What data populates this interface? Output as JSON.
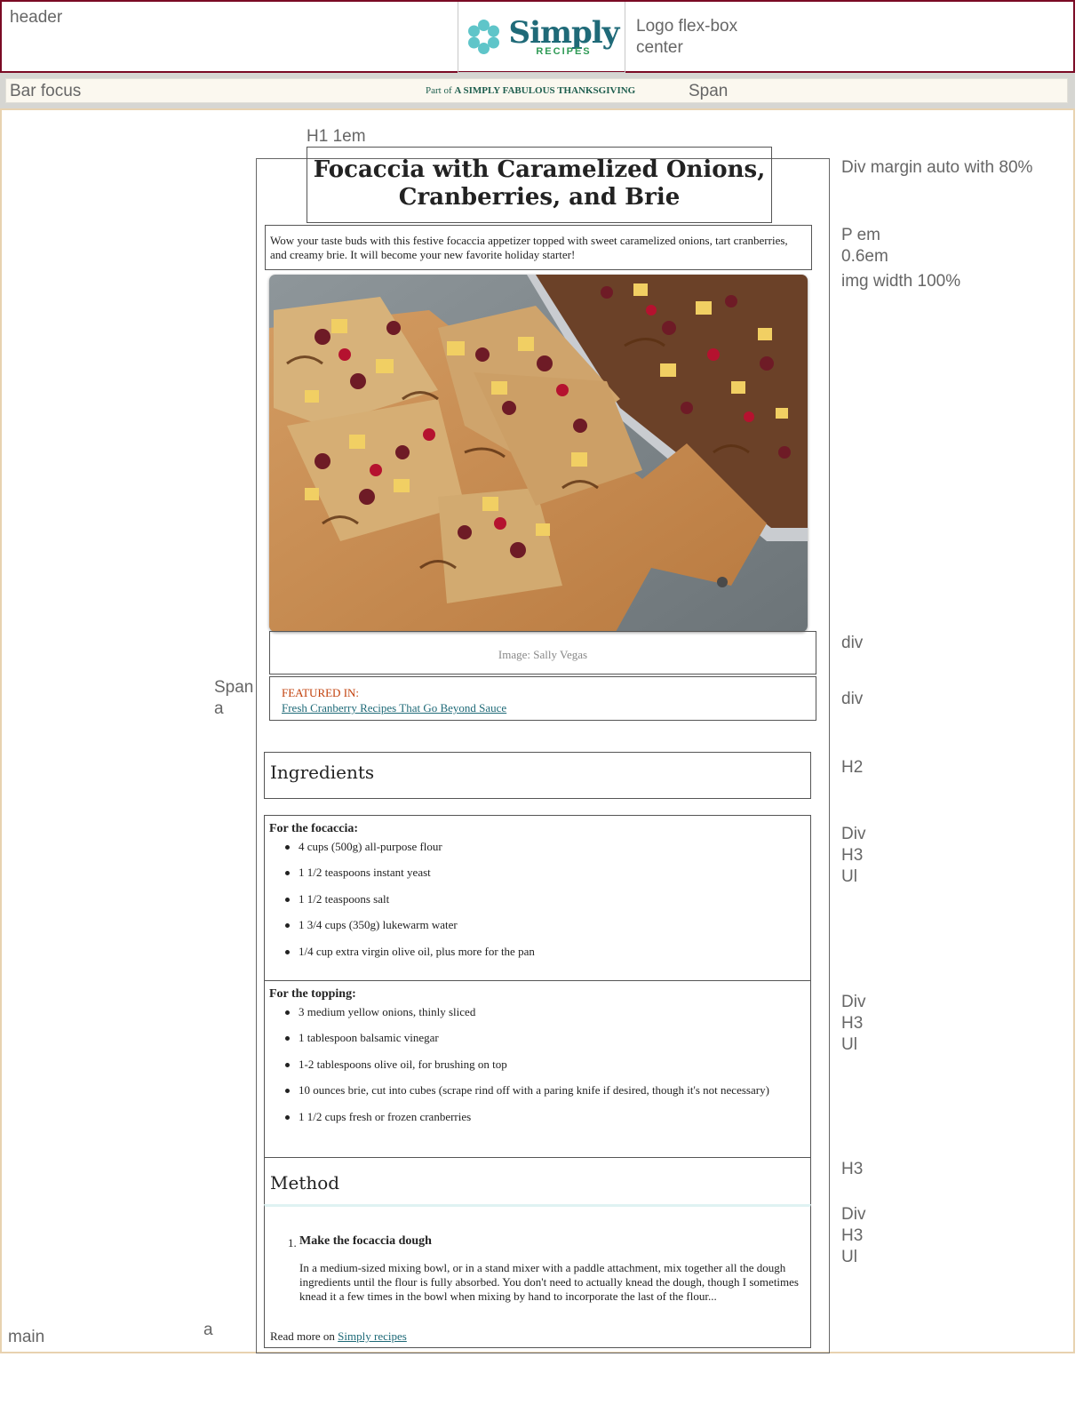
{
  "annotations": {
    "header": "header",
    "logo": "Logo flex-box center",
    "bar": "Bar focus",
    "span": "Span",
    "h1": "H1 1em",
    "div_margin": "Div margin auto with 80%",
    "p_em": "P em",
    "p_size": "0.6em",
    "img_width": "img width 100%",
    "div_credit": "div",
    "span_a_1": "Span",
    "span_a_2": "a",
    "div_featured": "div",
    "h2": "H2",
    "div1": "Div",
    "h3_1": "H3",
    "ul1": "Ul",
    "div2": "Div",
    "h3_2": "H3",
    "ul2": "Ul",
    "h3_method": "H3",
    "div3": "Div",
    "h3_3": "H3",
    "ul3": "Ul",
    "main": "main",
    "a": "a"
  },
  "logo": {
    "word": "Simply",
    "sub": "RECIPES",
    "flower_color": "#5fc5c9",
    "word_color": "#1f6a78",
    "sub_color": "#2e9a55"
  },
  "bar": {
    "prefix": "Part of ",
    "label": "A SIMPLY FABULOUS THANKSGIVING"
  },
  "article": {
    "title": "Focaccia with Caramelized Onions, Cranberries, and Brie",
    "intro": "Wow your taste buds with this festive focaccia appetizer topped with sweet caramelized onions, tart cranberries, and creamy brie. It will become your new favorite holiday starter!",
    "image_credit": "Image: Sally Vegas",
    "featured_label": "FEATURED IN:",
    "featured_link": "Fresh Cranberry Recipes That Go Beyond Sauce",
    "ingredients_heading": "Ingredients",
    "focaccia_heading": "For the focaccia:",
    "focaccia_items": [
      "4 cups (500g) all-purpose flour",
      "1 1/2 teaspoons instant yeast",
      "1 1/2 teaspoons salt",
      "1 3/4 cups (350g) lukewarm water",
      "1/4 cup extra virgin olive oil, plus more for the pan"
    ],
    "topping_heading": "For the topping:",
    "topping_items": [
      "3 medium yellow onions, thinly sliced",
      "1 tablespoon balsamic vinegar",
      "1-2 tablespoons olive oil, for brushing on top",
      "10 ounces brie, cut into cubes (scrape rind off with a paring knife if desired, though it's not necessary)",
      "1 1/2 cups fresh or frozen cranberries"
    ],
    "method_heading": "Method",
    "step_number": "1.",
    "step_title": "Make the focaccia dough",
    "step_body": "In a medium-sized mixing bowl, or in a stand mixer with a paddle attachment, mix together all the dough ingredients until the flour is fully absorbed. You don't need to actually knead the dough, though I sometimes knead it a few times in the bowl when mixing by hand to incorporate the last of the flour...",
    "read_more_prefix": "Read more on ",
    "read_more_link": "Simply recipes"
  }
}
